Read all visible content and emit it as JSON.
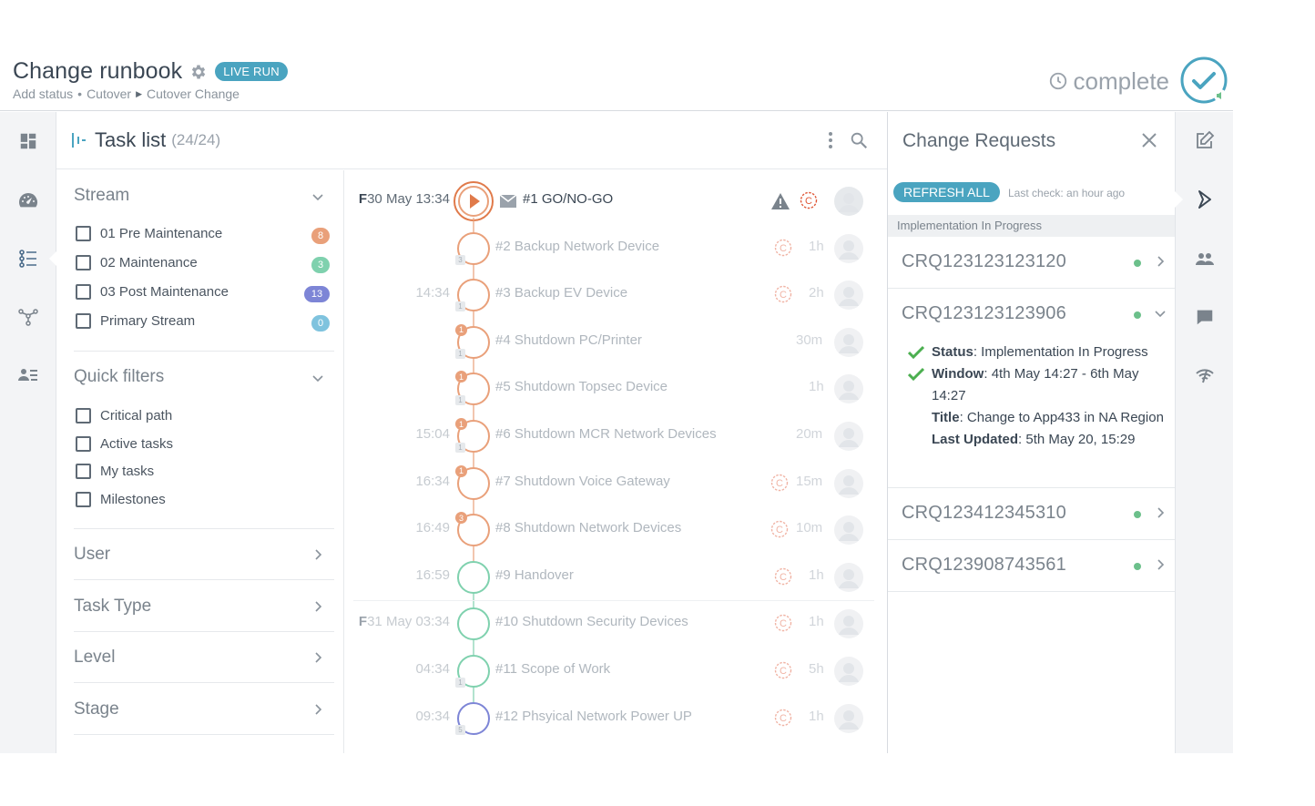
{
  "header": {
    "title": "Change runbook",
    "badge": "LIVE RUN",
    "breadcrumb": [
      "Add status",
      "Cutover",
      "Cutover Change"
    ],
    "status": "complete"
  },
  "nav": {
    "icons": [
      "dashboard-icon",
      "speedometer-icon",
      "task-list-icon",
      "branch-icon",
      "people-list-icon"
    ]
  },
  "tasklist": {
    "title": "Task list",
    "count": "(24/24)"
  },
  "filters": {
    "stream": {
      "title": "Stream",
      "items": [
        {
          "label": "01 Pre Maintenance",
          "count": "8",
          "color": "#e9a07a"
        },
        {
          "label": "02 Maintenance",
          "count": "3",
          "color": "#7fd1ae"
        },
        {
          "label": "03 Post Maintenance",
          "count": "13",
          "color": "#7d85d6"
        },
        {
          "label": "Primary Stream",
          "count": "0",
          "color": "#7fc3de"
        }
      ]
    },
    "quick": {
      "title": "Quick filters",
      "items": [
        "Critical path",
        "Active tasks",
        "My tasks",
        "Milestones"
      ]
    },
    "collapsed": [
      "User",
      "Task Type",
      "Level",
      "Stage"
    ]
  },
  "tasks": [
    {
      "prefix": "F",
      "date": "30 May 13:34",
      "title": "#1 GO/NO-GO",
      "duration": "",
      "color": "#e9a07a"
    },
    {
      "prefix": "",
      "date": "",
      "title": "#2 Backup Network Device",
      "duration": "1h",
      "color": "#e9a07a",
      "sub": "3"
    },
    {
      "prefix": "",
      "date": "14:34",
      "title": "#3 Backup EV Device",
      "duration": "2h",
      "color": "#e9a07a",
      "sub": "1"
    },
    {
      "prefix": "",
      "date": "",
      "title": "#4 Shutdown PC/Printer",
      "duration": "30m",
      "color": "#e9a07a",
      "badge": "1",
      "sub": "1"
    },
    {
      "prefix": "",
      "date": "",
      "title": "#5 Shutdown Topsec Device",
      "duration": "1h",
      "color": "#e9a07a",
      "badge": "1",
      "sub": "1"
    },
    {
      "prefix": "",
      "date": "15:04",
      "title": "#6 Shutdown MCR Network Devices",
      "duration": "20m",
      "color": "#e9a07a",
      "badge": "1",
      "sub": "1"
    },
    {
      "prefix": "",
      "date": "16:34",
      "title": "#7 Shutdown Voice Gateway",
      "duration": "15m",
      "color": "#e9a07a",
      "badge": "1"
    },
    {
      "prefix": "",
      "date": "16:49",
      "title": "#8 Shutdown Network Devices",
      "duration": "10m",
      "color": "#e9a07a",
      "badge": "3"
    },
    {
      "prefix": "",
      "date": "16:59",
      "title": "#9 Handover",
      "duration": "1h",
      "color": "#7fd1ae"
    },
    {
      "prefix": "F",
      "date": "31 May 03:34",
      "title": "#10 Shutdown Security Devices",
      "duration": "1h",
      "color": "#7fd1ae"
    },
    {
      "prefix": "",
      "date": "04:34",
      "title": "#11 Scope of Work",
      "duration": "5h",
      "color": "#7fd1ae",
      "sub": "1"
    },
    {
      "prefix": "",
      "date": "09:34",
      "title": "#12 Phsyical Network Power UP",
      "duration": "1h",
      "color": "#7d85d6",
      "sub": "5"
    }
  ],
  "change_requests": {
    "title": "Change Requests",
    "refresh": "REFRESH ALL",
    "last_check": "Last check: an hour ago",
    "group": "Implementation In Progress",
    "items": [
      {
        "id": "CRQ123123123120"
      },
      {
        "id": "CRQ123123123906",
        "status_label": "Status",
        "status": ": Implementation In Progress",
        "window_label": "Window",
        "window": ": 4th May 14:27 - 6th May 14:27",
        "title_label": "Title",
        "title": ": Change to App433 in NA Region",
        "updated_label": "Last Updated",
        "updated": ": 5th May 20, 15:29"
      },
      {
        "id": "CRQ123412345310"
      },
      {
        "id": "CRQ123908743561"
      }
    ]
  },
  "colors": {
    "accent": "#4aa4c0",
    "orange": "#e9a07a",
    "green": "#7fd1ae",
    "purple": "#7d85d6",
    "success": "#4caf50"
  }
}
